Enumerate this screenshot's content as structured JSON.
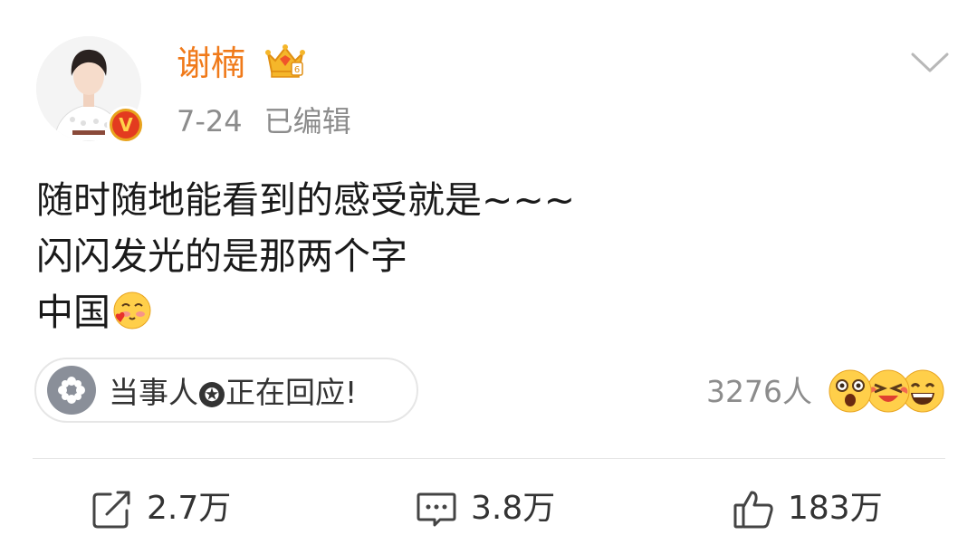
{
  "post": {
    "author": "谢楠",
    "date": "7-24",
    "edited_label": "已编辑",
    "content_lines": [
      "随时随地能看到的感受就是~~~",
      "闪闪发光的是那两个字",
      "中国"
    ],
    "inline_emoji": "shy-love-emoji"
  },
  "badge": {
    "verified_letter": "V",
    "colors": {
      "badge_ring": "#e8a31d",
      "badge_fill": "#e33b1f",
      "username": "#f07a1a"
    }
  },
  "topic_pill": {
    "text_before": "当事人",
    "star_glyph": "✪",
    "text_after": "正在回应!"
  },
  "reactions": {
    "count_text": "3276人",
    "icons": [
      "shocked-emoji-icon",
      "laughing-emoji-icon",
      "grinning-emoji-icon"
    ]
  },
  "actions": {
    "repost": {
      "icon": "share-icon",
      "label": "2.7万"
    },
    "comment": {
      "icon": "comment-icon",
      "label": "3.8万"
    },
    "like": {
      "icon": "thumbs-up-icon",
      "label": "183万"
    }
  }
}
